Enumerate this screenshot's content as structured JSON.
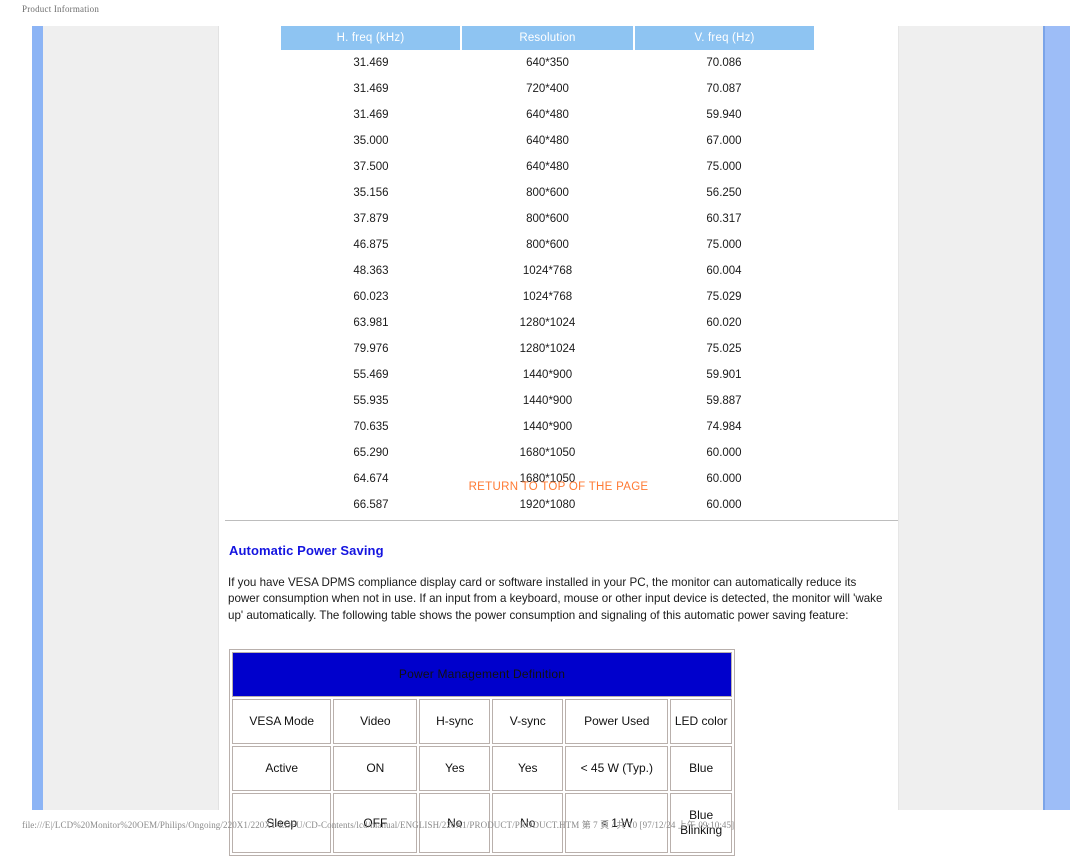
{
  "print": {
    "header": "Product Information",
    "footer": "file:///E|/LCD%20Monitor%20OEM/Philips/Ongoing/220X1/220X1-EDFU/CD-Contents/lcd/manual/ENGLISH/220X1/PRODUCT/PRODUCT.HTM 第 7 頁 / 共 10 [97/12/24 上午 09:10:45]"
  },
  "colors": {
    "timing_header_bg": "#8ec4f2",
    "return_link": "#ff7a33",
    "section_heading": "#1414e0",
    "pm_title_bg": "#0000cc",
    "sidebar_bar": "#8cb4f5",
    "panel_bg": "#efefef"
  },
  "timing_table": {
    "headers": [
      "H. freq (kHz)",
      "Resolution",
      "V. freq (Hz)"
    ],
    "rows": [
      [
        "31.469",
        "640*350",
        "70.086"
      ],
      [
        "31.469",
        "720*400",
        "70.087"
      ],
      [
        "31.469",
        "640*480",
        "59.940"
      ],
      [
        "35.000",
        "640*480",
        "67.000"
      ],
      [
        "37.500",
        "640*480",
        "75.000"
      ],
      [
        "35.156",
        "800*600",
        "56.250"
      ],
      [
        "37.879",
        "800*600",
        "60.317"
      ],
      [
        "46.875",
        "800*600",
        "75.000"
      ],
      [
        "48.363",
        "1024*768",
        "60.004"
      ],
      [
        "60.023",
        "1024*768",
        "75.029"
      ],
      [
        "63.981",
        "1280*1024",
        "60.020"
      ],
      [
        "79.976",
        "1280*1024",
        "75.025"
      ],
      [
        "55.469",
        "1440*900",
        "59.901"
      ],
      [
        "55.935",
        "1440*900",
        "59.887"
      ],
      [
        "70.635",
        "1440*900",
        "74.984"
      ],
      [
        "65.290",
        "1680*1050",
        "60.000"
      ],
      [
        "64.674",
        "1680*1050",
        "60.000"
      ],
      [
        "66.587",
        "1920*1080",
        "60.000"
      ]
    ]
  },
  "return_link_label": "RETURN TO TOP OF THE PAGE",
  "section": {
    "heading": "Automatic Power Saving",
    "paragraph": "If you have VESA DPMS compliance display card or software installed in your PC, the monitor can automatically reduce its power consumption when not in use. If an input from a keyboard, mouse or other input device is detected, the monitor will 'wake up' automatically. The following table shows the power consumption and signaling of this automatic power saving feature:"
  },
  "power_table": {
    "title": "Power Management Definition",
    "headers": [
      "VESA Mode",
      "Video",
      "H-sync",
      "V-sync",
      "Power Used",
      "LED color"
    ],
    "rows": [
      [
        "Active",
        "ON",
        "Yes",
        "Yes",
        "< 45 W (Typ.)",
        "Blue"
      ],
      [
        "Sleep",
        "OFF",
        "No",
        "No",
        "< 1 W",
        "Blue Blinking"
      ]
    ]
  }
}
